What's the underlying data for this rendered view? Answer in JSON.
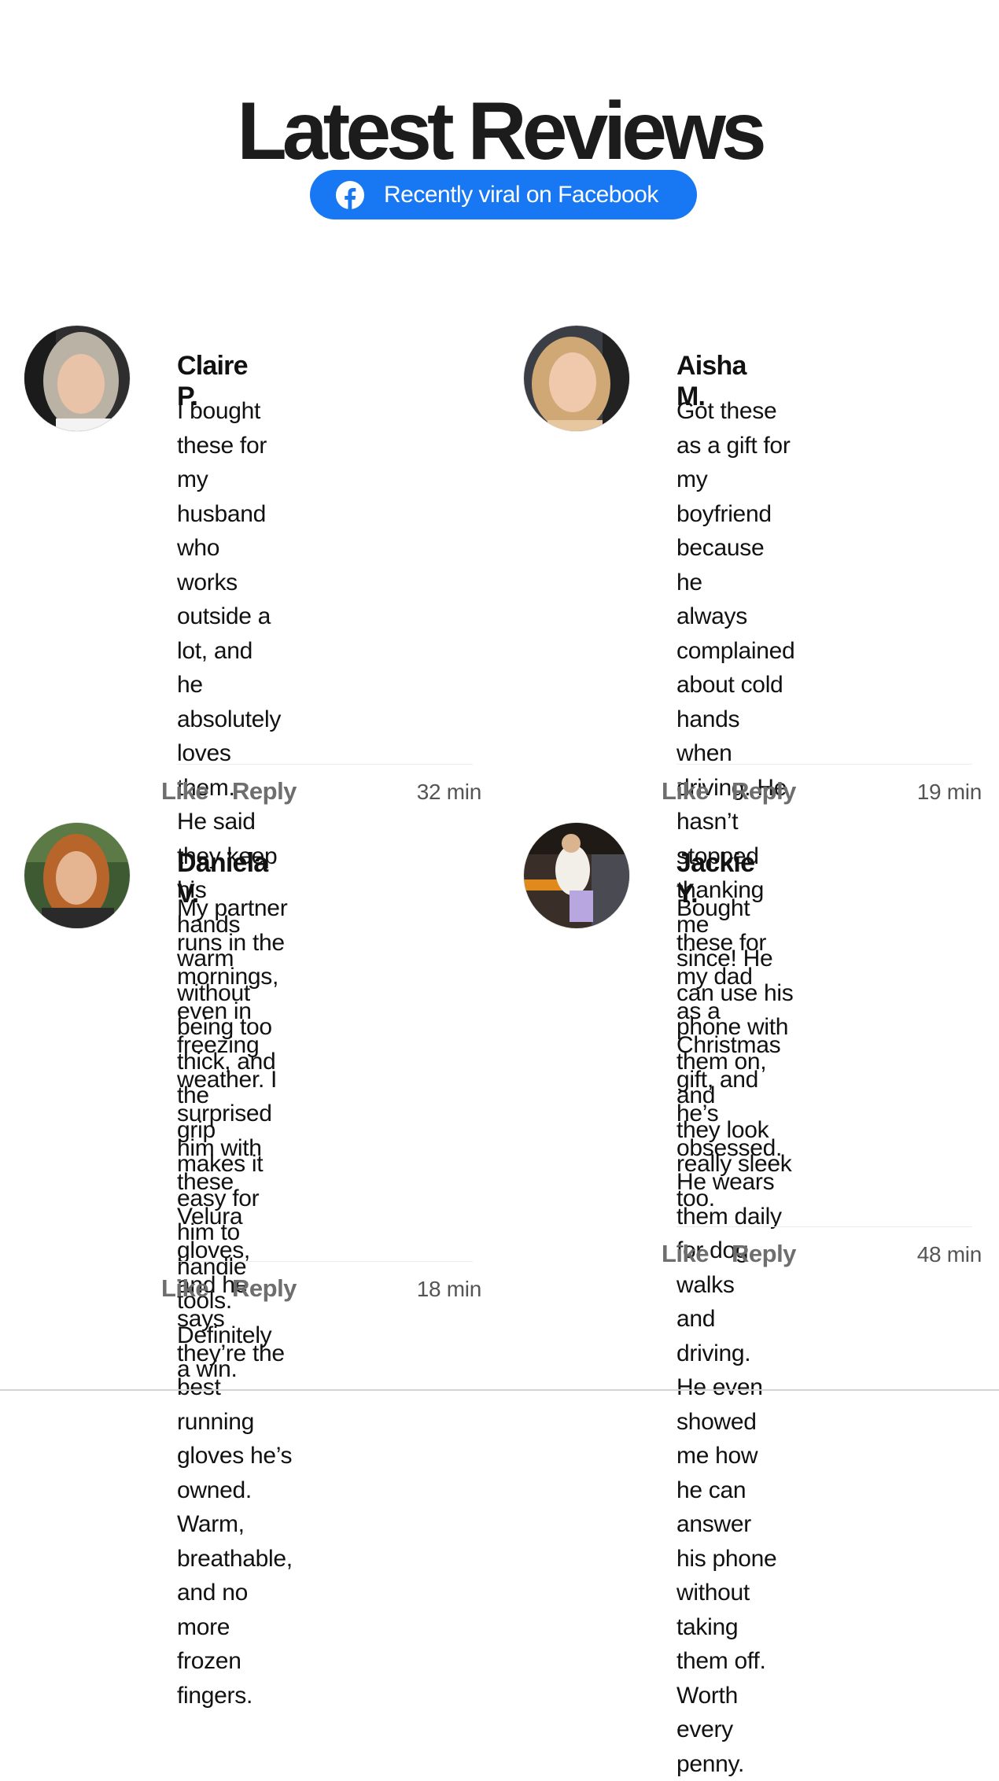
{
  "header": {
    "title": "Latest Reviews",
    "badge_label": "Recently viral on Facebook",
    "badge_icon": "facebook-icon",
    "badge_color": "#1877f2"
  },
  "reviews": [
    {
      "name": "Claire P.",
      "lines": [
        "I bought these for my",
        "husband who works",
        "outside a lot, and he",
        "absolutely loves them.",
        "He said they keep his",
        "hands warm without",
        "being too thick, and the",
        "grip makes it easy for",
        "him to handle tools.",
        "Definitely a win."
      ],
      "like_label": "Like",
      "reply_label": "Reply",
      "time": "32 min"
    },
    {
      "name": "Aisha M.",
      "lines": [
        "Got these as a gift for my",
        "boyfriend because he",
        "always complained",
        "about cold hands when",
        "driving. He hasn’t",
        "stopped thanking me",
        "since! He can use his",
        "phone with them on, and",
        "they look really sleek",
        "too."
      ],
      "like_label": "Like",
      "reply_label": "Reply",
      "time": "19 min"
    },
    {
      "name": "Daniela V.",
      "lines": [
        "My partner runs in the",
        "mornings, even in",
        "freezing weather. I",
        "surprised him with these",
        "Velura gloves, and he",
        "says they’re the best",
        "running gloves he’s",
        "owned. Warm,",
        "breathable, and no more",
        "frozen fingers."
      ],
      "like_label": "Like",
      "reply_label": "Reply",
      "time": "18 min"
    },
    {
      "name": "Jackie Y.",
      "lines": [
        "Bought these for my dad",
        "as a Christmas gift, and",
        "he’s obsessed. He wears",
        "them daily for dog walks",
        "and driving. He even",
        "showed me how he can",
        "answer his phone",
        "without taking them off.",
        "Worth every penny."
      ],
      "like_label": "Like",
      "reply_label": "Reply",
      "time": "48 min"
    }
  ]
}
